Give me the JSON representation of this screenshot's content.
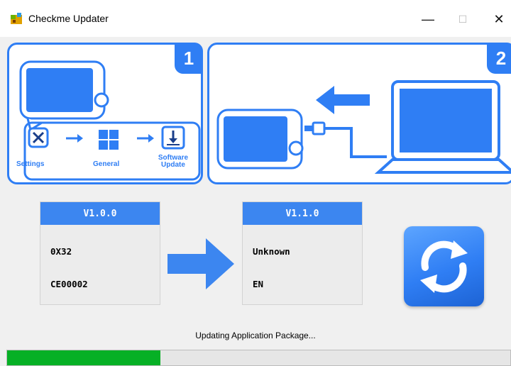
{
  "window": {
    "title": "Checkme Updater",
    "minimize_glyph": "—",
    "maximize_glyph": "☐",
    "close_glyph": "✕"
  },
  "step1": {
    "badge": "1",
    "labels": {
      "settings": "Settings",
      "general": "General",
      "software_line1": "Software",
      "software_line2": "Update"
    },
    "icons": [
      "device-icon",
      "tools-icon",
      "windows-logo-icon",
      "download-icon"
    ]
  },
  "step2": {
    "badge": "2",
    "icons": [
      "device-icon",
      "usb-cable-icon",
      "arrow-left-icon",
      "laptop-icon"
    ]
  },
  "versions": {
    "current": {
      "header": "V1.0.0",
      "line1": "0X32",
      "line2": "CE00002"
    },
    "new": {
      "header": "V1.1.0",
      "line1": "Unknown",
      "line2": "EN"
    }
  },
  "update_icon": "sync-icon",
  "status": {
    "text": "Updating Application Package..."
  },
  "progress": {
    "fraction": 0.305
  },
  "colors": {
    "accent": "#2f7ef4",
    "progress": "#06b025",
    "version_header": "#3c86f0"
  }
}
